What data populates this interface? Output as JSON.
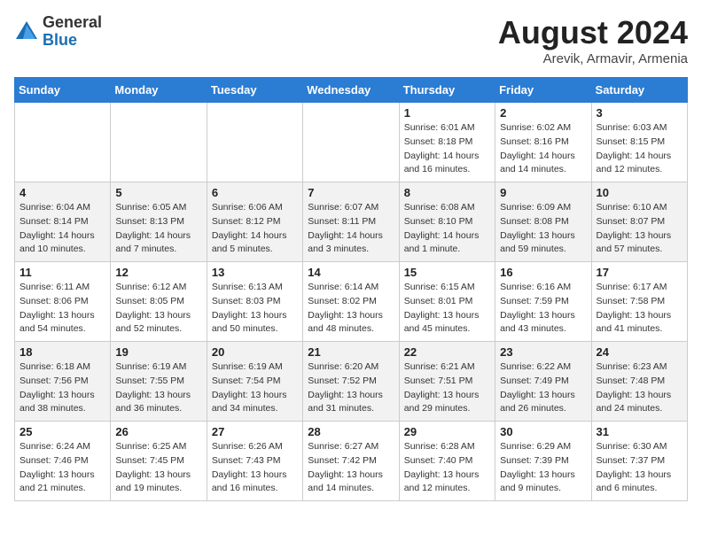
{
  "logo": {
    "general": "General",
    "blue": "Blue"
  },
  "title": "August 2024",
  "subtitle": "Arevik, Armavir, Armenia",
  "days_of_week": [
    "Sunday",
    "Monday",
    "Tuesday",
    "Wednesday",
    "Thursday",
    "Friday",
    "Saturday"
  ],
  "weeks": [
    [
      {
        "day": "",
        "info": ""
      },
      {
        "day": "",
        "info": ""
      },
      {
        "day": "",
        "info": ""
      },
      {
        "day": "",
        "info": ""
      },
      {
        "day": "1",
        "info": "Sunrise: 6:01 AM\nSunset: 8:18 PM\nDaylight: 14 hours and 16 minutes."
      },
      {
        "day": "2",
        "info": "Sunrise: 6:02 AM\nSunset: 8:16 PM\nDaylight: 14 hours and 14 minutes."
      },
      {
        "day": "3",
        "info": "Sunrise: 6:03 AM\nSunset: 8:15 PM\nDaylight: 14 hours and 12 minutes."
      }
    ],
    [
      {
        "day": "4",
        "info": "Sunrise: 6:04 AM\nSunset: 8:14 PM\nDaylight: 14 hours and 10 minutes."
      },
      {
        "day": "5",
        "info": "Sunrise: 6:05 AM\nSunset: 8:13 PM\nDaylight: 14 hours and 7 minutes."
      },
      {
        "day": "6",
        "info": "Sunrise: 6:06 AM\nSunset: 8:12 PM\nDaylight: 14 hours and 5 minutes."
      },
      {
        "day": "7",
        "info": "Sunrise: 6:07 AM\nSunset: 8:11 PM\nDaylight: 14 hours and 3 minutes."
      },
      {
        "day": "8",
        "info": "Sunrise: 6:08 AM\nSunset: 8:10 PM\nDaylight: 14 hours and 1 minute."
      },
      {
        "day": "9",
        "info": "Sunrise: 6:09 AM\nSunset: 8:08 PM\nDaylight: 13 hours and 59 minutes."
      },
      {
        "day": "10",
        "info": "Sunrise: 6:10 AM\nSunset: 8:07 PM\nDaylight: 13 hours and 57 minutes."
      }
    ],
    [
      {
        "day": "11",
        "info": "Sunrise: 6:11 AM\nSunset: 8:06 PM\nDaylight: 13 hours and 54 minutes."
      },
      {
        "day": "12",
        "info": "Sunrise: 6:12 AM\nSunset: 8:05 PM\nDaylight: 13 hours and 52 minutes."
      },
      {
        "day": "13",
        "info": "Sunrise: 6:13 AM\nSunset: 8:03 PM\nDaylight: 13 hours and 50 minutes."
      },
      {
        "day": "14",
        "info": "Sunrise: 6:14 AM\nSunset: 8:02 PM\nDaylight: 13 hours and 48 minutes."
      },
      {
        "day": "15",
        "info": "Sunrise: 6:15 AM\nSunset: 8:01 PM\nDaylight: 13 hours and 45 minutes."
      },
      {
        "day": "16",
        "info": "Sunrise: 6:16 AM\nSunset: 7:59 PM\nDaylight: 13 hours and 43 minutes."
      },
      {
        "day": "17",
        "info": "Sunrise: 6:17 AM\nSunset: 7:58 PM\nDaylight: 13 hours and 41 minutes."
      }
    ],
    [
      {
        "day": "18",
        "info": "Sunrise: 6:18 AM\nSunset: 7:56 PM\nDaylight: 13 hours and 38 minutes."
      },
      {
        "day": "19",
        "info": "Sunrise: 6:19 AM\nSunset: 7:55 PM\nDaylight: 13 hours and 36 minutes."
      },
      {
        "day": "20",
        "info": "Sunrise: 6:19 AM\nSunset: 7:54 PM\nDaylight: 13 hours and 34 minutes."
      },
      {
        "day": "21",
        "info": "Sunrise: 6:20 AM\nSunset: 7:52 PM\nDaylight: 13 hours and 31 minutes."
      },
      {
        "day": "22",
        "info": "Sunrise: 6:21 AM\nSunset: 7:51 PM\nDaylight: 13 hours and 29 minutes."
      },
      {
        "day": "23",
        "info": "Sunrise: 6:22 AM\nSunset: 7:49 PM\nDaylight: 13 hours and 26 minutes."
      },
      {
        "day": "24",
        "info": "Sunrise: 6:23 AM\nSunset: 7:48 PM\nDaylight: 13 hours and 24 minutes."
      }
    ],
    [
      {
        "day": "25",
        "info": "Sunrise: 6:24 AM\nSunset: 7:46 PM\nDaylight: 13 hours and 21 minutes."
      },
      {
        "day": "26",
        "info": "Sunrise: 6:25 AM\nSunset: 7:45 PM\nDaylight: 13 hours and 19 minutes."
      },
      {
        "day": "27",
        "info": "Sunrise: 6:26 AM\nSunset: 7:43 PM\nDaylight: 13 hours and 16 minutes."
      },
      {
        "day": "28",
        "info": "Sunrise: 6:27 AM\nSunset: 7:42 PM\nDaylight: 13 hours and 14 minutes."
      },
      {
        "day": "29",
        "info": "Sunrise: 6:28 AM\nSunset: 7:40 PM\nDaylight: 13 hours and 12 minutes."
      },
      {
        "day": "30",
        "info": "Sunrise: 6:29 AM\nSunset: 7:39 PM\nDaylight: 13 hours and 9 minutes."
      },
      {
        "day": "31",
        "info": "Sunrise: 6:30 AM\nSunset: 7:37 PM\nDaylight: 13 hours and 6 minutes."
      }
    ]
  ]
}
